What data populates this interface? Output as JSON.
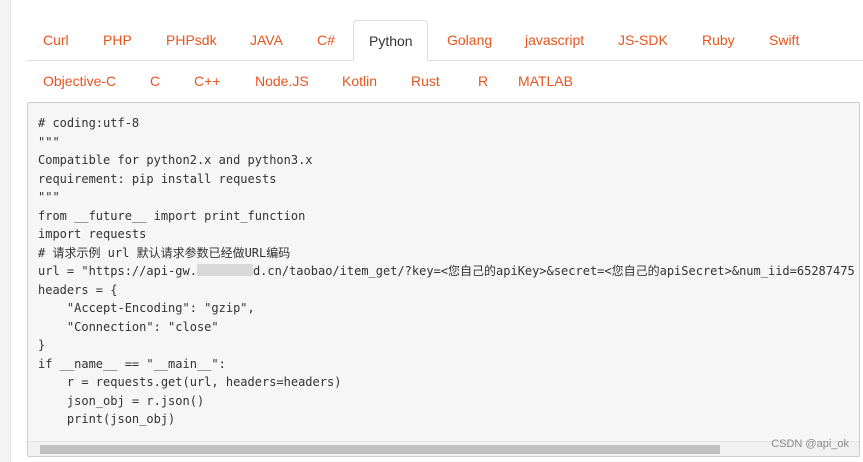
{
  "tabs": {
    "row1": [
      "Curl",
      "PHP",
      "PHPsdk",
      "JAVA",
      "C#",
      "Python",
      "Golang",
      "javascript",
      "JS-SDK",
      "Ruby",
      "Swift"
    ],
    "row2": [
      "Objective-C",
      "C",
      "C++",
      "Node.JS",
      "Kotlin",
      "Rust",
      "R",
      "MATLAB"
    ],
    "active": "Python"
  },
  "code": {
    "lines": [
      "# coding:utf-8",
      "\"\"\"",
      "Compatible for python2.x and python3.x",
      "requirement: pip install requests",
      "\"\"\"",
      "from __future__ import print_function",
      "import requests",
      "# 请求示例 url 默认请求参数已经做URL编码",
      "headers = {",
      "    \"Accept-Encoding\": \"gzip\",",
      "    \"Connection\": \"close\"",
      "}",
      "if __name__ == \"__main__\":",
      "    r = requests.get(url, headers=headers)",
      "    json_obj = r.json()",
      "    print(json_obj)"
    ],
    "url_line_prefix": "url = \"https://api-gw.",
    "url_line_suffix": "d.cn/taobao/item_get/?key=<您自己的apiKey>&secret=<您自己的apiSecret>&num_iid=65287475"
  },
  "watermark": "CSDN @api_ok",
  "colors": {
    "tab_link": "#e8541e",
    "tab_active": "#333333",
    "code_bg": "#f6f6f6"
  }
}
